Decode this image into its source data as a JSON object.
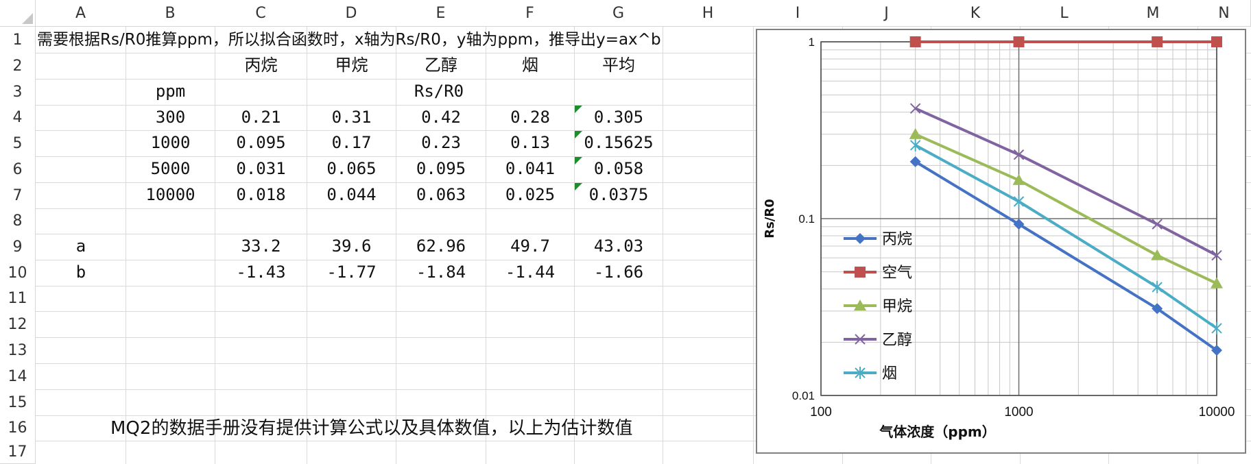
{
  "columns": [
    "A",
    "B",
    "C",
    "D",
    "E",
    "F",
    "G",
    "H",
    "I",
    "J",
    "K",
    "L",
    "M",
    "N"
  ],
  "rows": [
    "1",
    "2",
    "3",
    "4",
    "5",
    "6",
    "7",
    "8",
    "9",
    "10",
    "11",
    "12",
    "13",
    "14",
    "15",
    "16",
    "17"
  ],
  "cells": {
    "r1": "需要根据Rs/R0推算ppm，所以拟合函数时，x轴为Rs/R0，y轴为ppm，推导出y=ax^b",
    "headers": [
      "丙烷",
      "甲烷",
      "乙醇",
      "烟",
      "平均"
    ],
    "ppm_label": "ppm",
    "rs_label": "Rs/R0",
    "ppm": [
      "300",
      "1000",
      "5000",
      "10000"
    ],
    "data": [
      [
        "0.21",
        "0.31",
        "0.42",
        "0.28",
        "0.305"
      ],
      [
        "0.095",
        "0.17",
        "0.23",
        "0.13",
        "0.15625"
      ],
      [
        "0.031",
        "0.065",
        "0.095",
        "0.041",
        "0.058"
      ],
      [
        "0.018",
        "0.044",
        "0.063",
        "0.025",
        "0.0375"
      ]
    ],
    "a_label": "a",
    "b_label": "b",
    "a_values": [
      "33.2",
      "39.6",
      "62.96",
      "49.7",
      "43.03"
    ],
    "b_values": [
      "-1.43",
      "-1.77",
      "-1.84",
      "-1.44",
      "-1.66"
    ],
    "note": "MQ2的数据手册没有提供计算公式以及具体数值，以上为估计数值"
  },
  "chart_data": {
    "type": "line",
    "title": "",
    "xlabel": "气体浓度（ppm）",
    "ylabel": "Rs/R0",
    "xscale": "log",
    "yscale": "log",
    "xlim": [
      200,
      10000
    ],
    "ylim": [
      0.01,
      1
    ],
    "x_ticks": [
      "100",
      "1000",
      "10000"
    ],
    "y_ticks": [
      "1",
      "0.1",
      "0.01"
    ],
    "grid": true,
    "legend_position": "left",
    "series": [
      {
        "name": "丙烷",
        "color": "#4472c4",
        "marker": "diamond",
        "x": [
          300,
          1000,
          5000,
          10000
        ],
        "y": [
          0.21,
          0.093,
          0.031,
          0.018
        ]
      },
      {
        "name": "空气",
        "color": "#c0504d",
        "marker": "square",
        "x": [
          300,
          1000,
          5000,
          10000
        ],
        "y": [
          1,
          1,
          1,
          1
        ]
      },
      {
        "name": "甲烷",
        "color": "#9bbb59",
        "marker": "triangle",
        "x": [
          300,
          1000,
          5000,
          10000
        ],
        "y": [
          0.3,
          0.165,
          0.062,
          0.043
        ]
      },
      {
        "name": "乙醇",
        "color": "#8064a2",
        "marker": "x",
        "x": [
          300,
          1000,
          5000,
          10000
        ],
        "y": [
          0.42,
          0.23,
          0.093,
          0.062
        ]
      },
      {
        "name": "烟",
        "color": "#4bacc6",
        "marker": "star",
        "x": [
          300,
          1000,
          5000,
          10000
        ],
        "y": [
          0.26,
          0.125,
          0.041,
          0.024
        ]
      }
    ]
  }
}
